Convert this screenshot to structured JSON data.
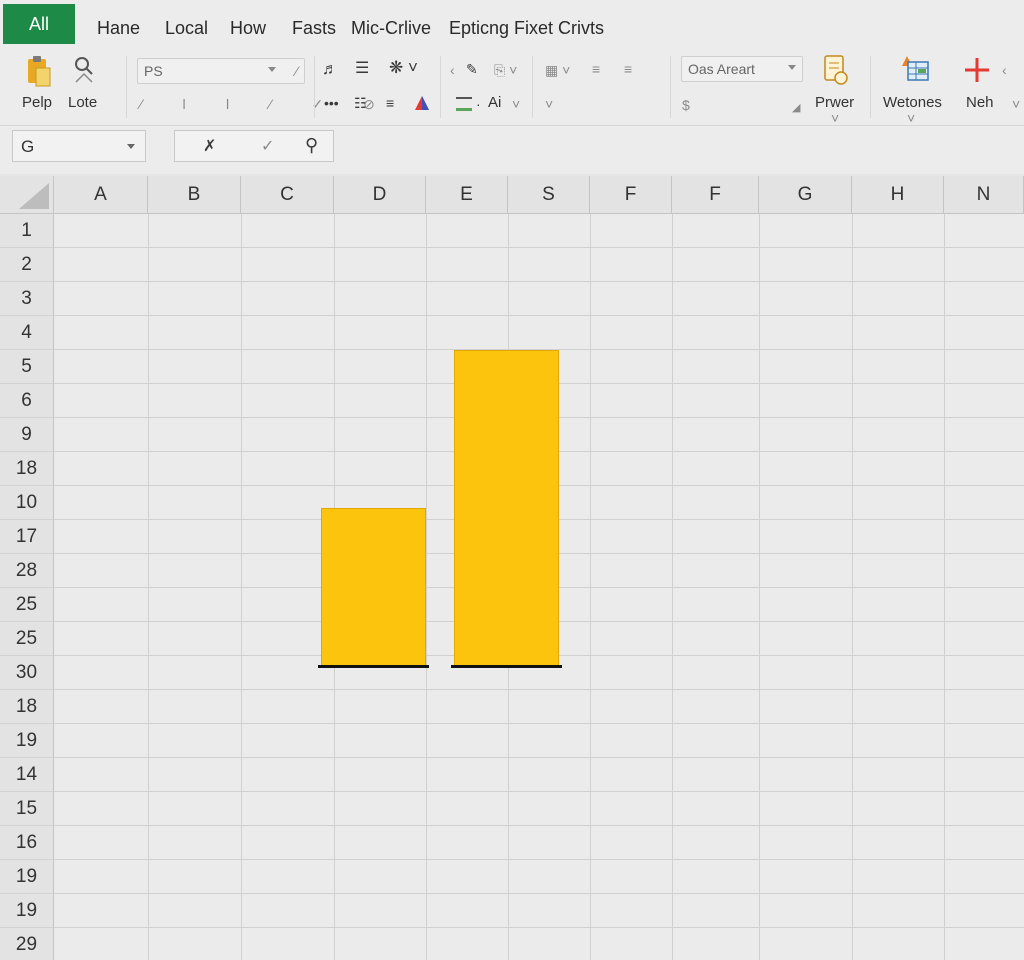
{
  "menu": {
    "active_tab": "All",
    "items": [
      "Hane",
      "Local",
      "How",
      "Fasts",
      "Mic-Crlive",
      "Epticng Fixet Crivts"
    ]
  },
  "ribbon": {
    "paste_label": "Pelp",
    "lote_label": "Lote",
    "font_select": "PS",
    "number_select": "Oas Areart",
    "number_sub": "$",
    "text_ai": "Ai",
    "prwer_label": "Prwer",
    "wetones_label": "Wetones",
    "neh_label": "Neh"
  },
  "formula_bar": {
    "name_box": "G"
  },
  "sheet": {
    "columns": [
      "A",
      "B",
      "C",
      "D",
      "E",
      "S",
      "F",
      "F",
      "G",
      "H",
      "N"
    ],
    "rows": [
      "1",
      "2",
      "3",
      "4",
      "5",
      "6",
      "9",
      "18",
      "10",
      "17",
      "28",
      "25",
      "25",
      "30",
      "18",
      "19",
      "14",
      "15",
      "16",
      "19",
      "19",
      "29"
    ]
  },
  "chart_data": {
    "type": "bar",
    "values": [
      9,
      18
    ],
    "ylim": [
      0,
      18
    ],
    "color": "#fcc40c"
  },
  "colors": {
    "accent": "#1e8a47",
    "bar": "#fcc40c",
    "add_icon": "#e53935"
  }
}
